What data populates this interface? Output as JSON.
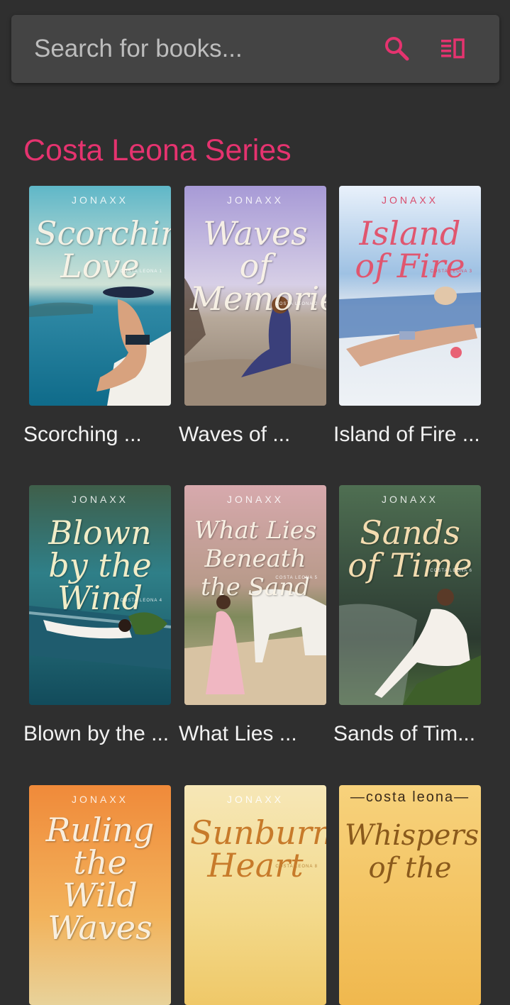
{
  "search": {
    "placeholder": "Search for books...",
    "search_icon": "search-icon",
    "view_icon": "list-view-icon"
  },
  "colors": {
    "accent": "#e5336f",
    "background": "#2f2f2f",
    "search_bar": "#444444"
  },
  "section": {
    "title": "Costa Leona Series"
  },
  "books": [
    {
      "title": "Scorching ...",
      "cover_brand": "JONAXX",
      "cover_title": "Scorching Love",
      "cover_series": "COSTA LEONA 1"
    },
    {
      "title": "Waves of ...",
      "cover_brand": "JONAXX",
      "cover_title": "Waves of Memories",
      "cover_series": "COSTA LEONA 2"
    },
    {
      "title": "Island of Fire ...",
      "cover_brand": "JONAXX",
      "cover_title": "Island of Fire",
      "cover_series": "COSTA LEONA 3"
    },
    {
      "title": "Blown by the ...",
      "cover_brand": "JONAXX",
      "cover_title": "Blown by the Wind",
      "cover_series": "COSTA LEONA 4"
    },
    {
      "title": "What Lies ...",
      "cover_brand": "JONAXX",
      "cover_title": "What Lies Beneath the Sand",
      "cover_series": "COSTA LEONA 5"
    },
    {
      "title": "Sands of Tim...",
      "cover_brand": "JONAXX",
      "cover_title": "Sands of Time",
      "cover_series": "COSTA LEONA 6"
    },
    {
      "title": "",
      "cover_brand": "JONAXX",
      "cover_title": "Ruling the Wild Waves",
      "cover_series": ""
    },
    {
      "title": "",
      "cover_brand": "JONAXX",
      "cover_title": "Sunburned Heart",
      "cover_series": "COSTA LEONA 8"
    },
    {
      "title": "",
      "cover_brand": "—costa leona—",
      "cover_title": "Whispers of the",
      "cover_series": ""
    }
  ]
}
